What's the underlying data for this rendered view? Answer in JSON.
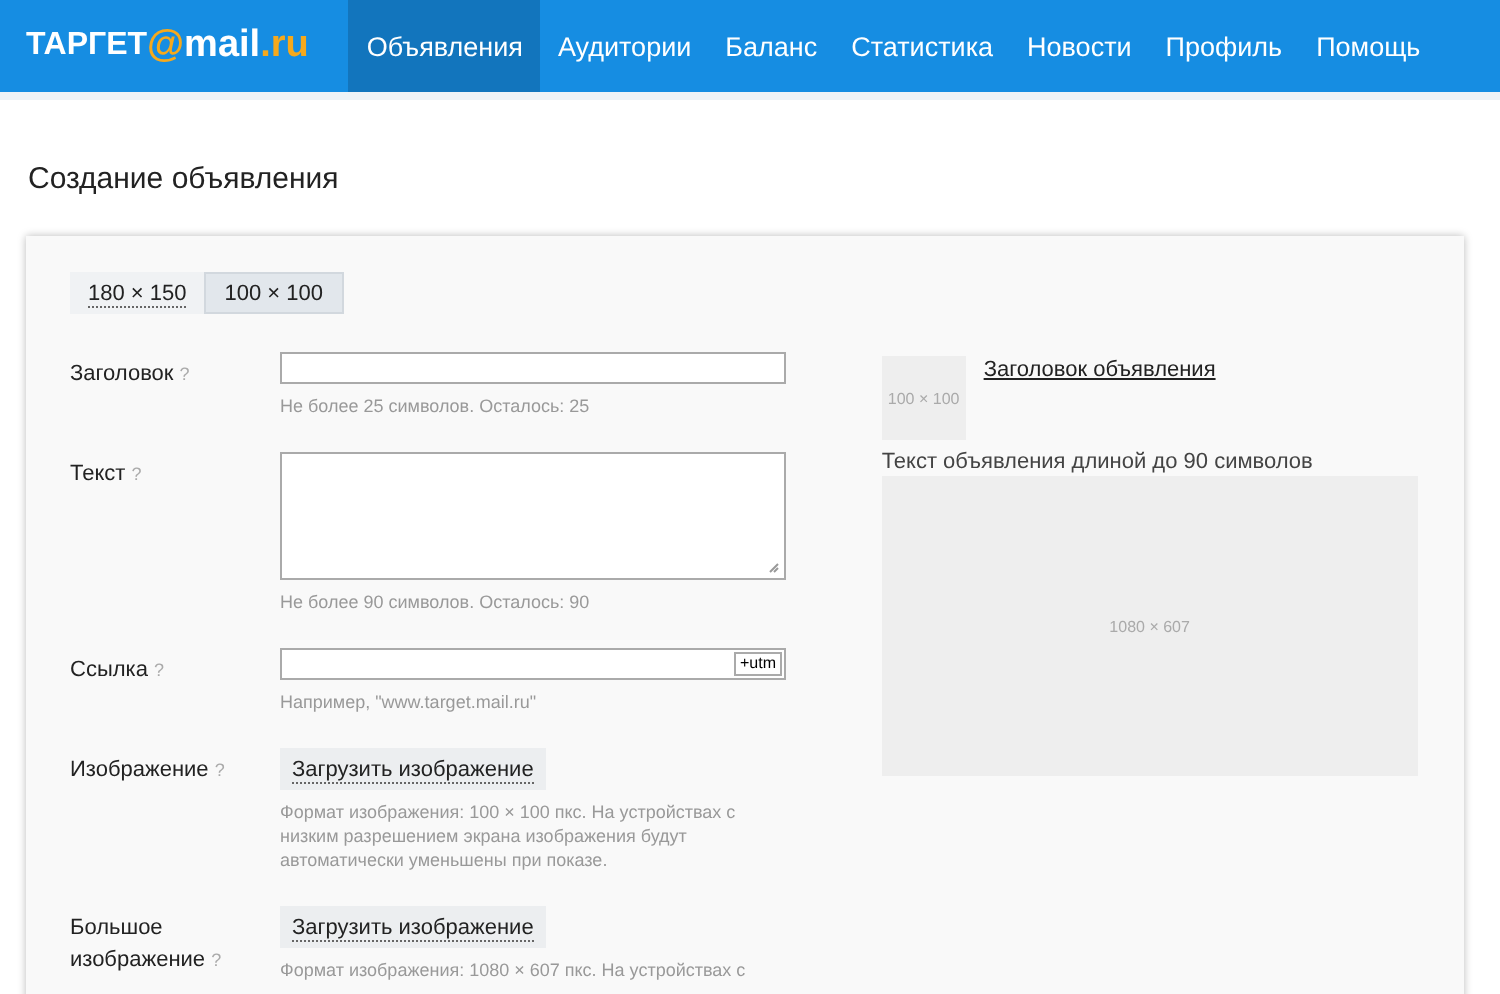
{
  "logo": [
    {
      "text": "ТАРГЕТ",
      "kind": "plain"
    },
    {
      "text": "@",
      "kind": "accent"
    },
    {
      "text": "mail",
      "kind": "plain"
    },
    {
      "text": ".ru",
      "kind": "accent"
    }
  ],
  "nav": [
    {
      "label": "Объявления",
      "selected": true
    },
    {
      "label": "Аудитории",
      "selected": false
    },
    {
      "label": "Баланс",
      "selected": false
    },
    {
      "label": "Статистика",
      "selected": false
    },
    {
      "label": "Новости",
      "selected": false
    },
    {
      "label": "Профиль",
      "selected": false
    },
    {
      "label": "Помощь",
      "selected": false
    }
  ],
  "page_title": "Создание объявления",
  "format_tabs": [
    {
      "label": "180 × 150",
      "selected": false
    },
    {
      "label": "100 × 100",
      "selected": true
    }
  ],
  "fields": [
    {
      "kind": "input",
      "label": "Заголовок",
      "help": "?",
      "hint": [
        "Не более 25 символов. Осталось: 25"
      ]
    },
    {
      "kind": "textarea",
      "label": "Текст",
      "help": "?",
      "hint": [
        "Не более 90 символов. Осталось: 90"
      ]
    },
    {
      "kind": "url",
      "label": "Ссылка",
      "help": "?",
      "addon": "+utm",
      "hint": [
        "Например, \"www.target.mail.ru\""
      ]
    },
    {
      "kind": "upload",
      "label": "Изображение",
      "help": "?",
      "button": "Загрузить изображение",
      "hint": [
        "Формат изображения: 100 × 100 пкс. На устройствах с",
        "низким разрешением экрана изображения будут",
        "автоматически уменьшены при показе."
      ]
    },
    {
      "kind": "upload",
      "label": "Большое изображение",
      "help": "?",
      "button": "Загрузить изображение",
      "hint": [
        "Формат изображения: 1080 × 607 пкс. На устройствах с"
      ]
    }
  ],
  "preview": {
    "thumb": "100 × 100",
    "headline": "Заголовок объявления",
    "text": "Текст объявления длиной до 90 символов",
    "large": "1080 × 607"
  }
}
